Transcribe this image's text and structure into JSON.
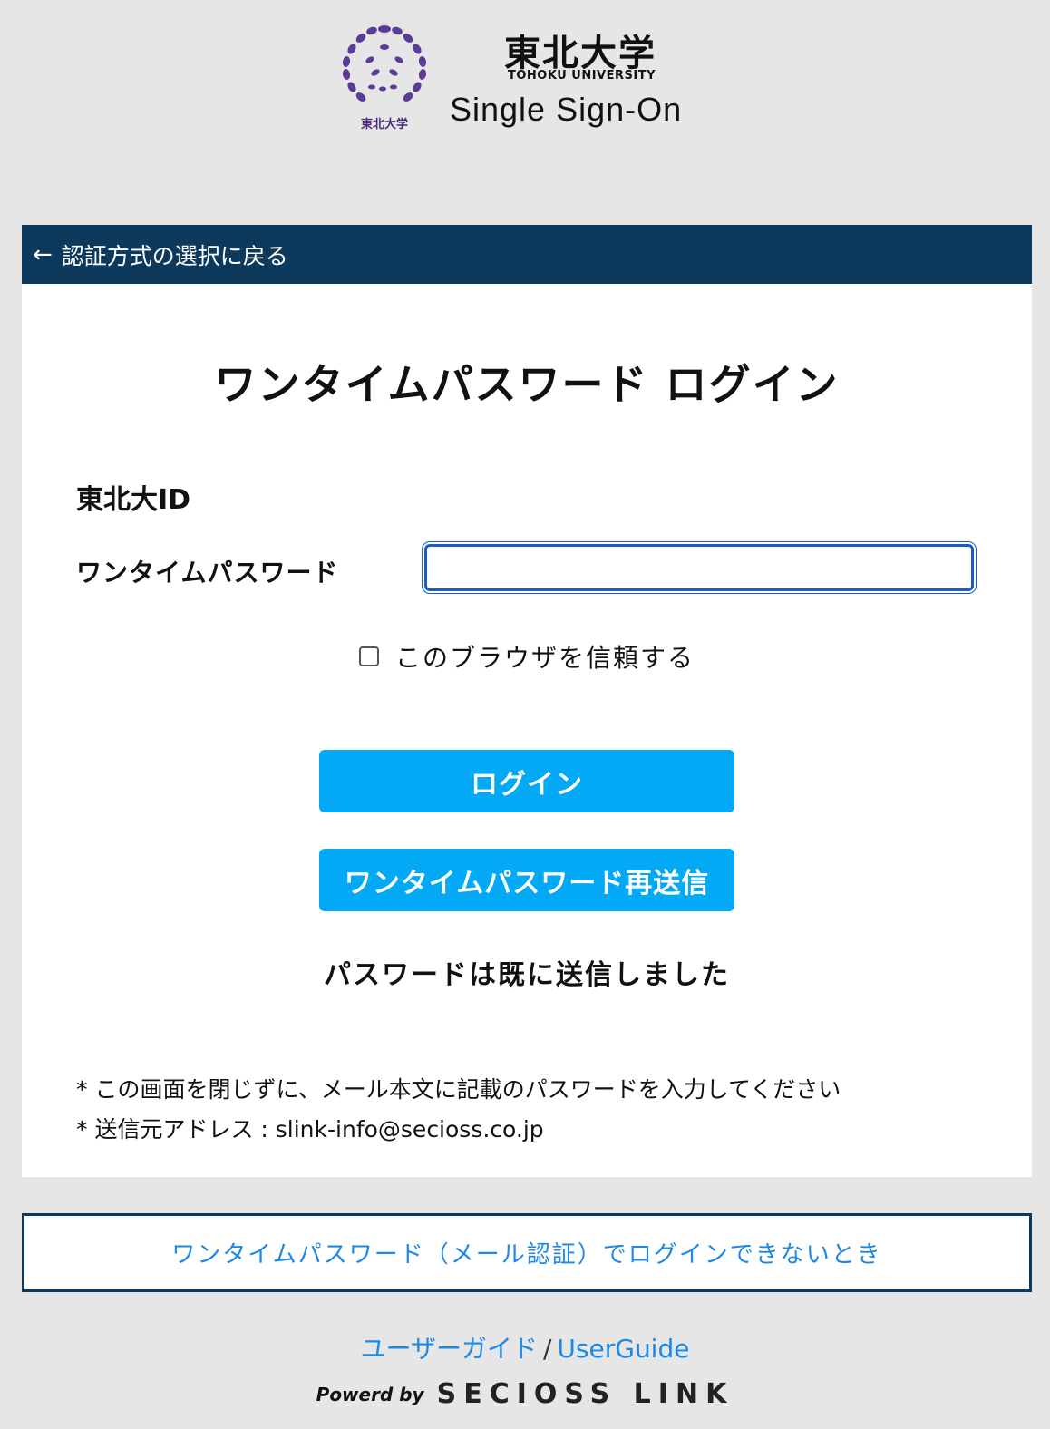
{
  "header": {
    "seal_text": "東北大学",
    "brand_jp": "東北大学",
    "brand_en": "TOHOKU UNIVERSITY",
    "brand_sso": "Single Sign-On"
  },
  "nav": {
    "back_arrow": "←",
    "back_label": "認証方式の選択に戻る"
  },
  "form": {
    "title": "ワンタイムパスワード ログイン",
    "id_label": "東北大ID",
    "otp_label": "ワンタイムパスワード",
    "otp_value": "",
    "trust_label": "このブラウザを信頼する",
    "trust_checked": false,
    "login_button": "ログイン",
    "resend_button": "ワンタイムパスワード再送信",
    "sent_message": "パスワードは既に送信しました",
    "notes": [
      "* この画面を閉じずに、メール本文に記載のパスワードを入力してください",
      "* 送信元アドレス : slink-info@secioss.co.jp"
    ]
  },
  "help": {
    "link_label": "ワンタイムパスワード（メール認証）でログインできないとき"
  },
  "footer": {
    "guide_jp": "ユーザーガイド",
    "separator": "/",
    "guide_en": "UserGuide",
    "powered_by": "Powerd by",
    "vendor_logo": "SECIOSS LINK"
  },
  "colors": {
    "background": "#e6e6e6",
    "nav_bar": "#0d3a5c",
    "button": "#03a9f4",
    "link": "#1e88e5",
    "seal_purple": "#4a2a7a"
  }
}
